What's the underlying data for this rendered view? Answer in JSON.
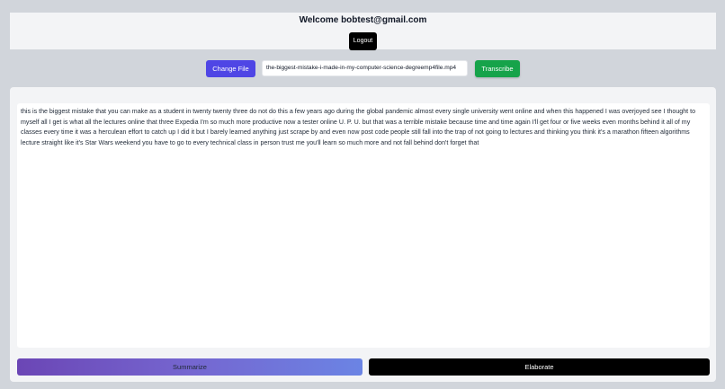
{
  "header": {
    "welcome_text": "Welcome bobtest@gmail.com",
    "logout_label": "Logout"
  },
  "toolbar": {
    "change_file_label": "Change File",
    "file_name": "the-biggest-mistake-i-made-in-my-computer-science-degreemp4file.mp4",
    "transcribe_label": "Transcribe"
  },
  "transcript": {
    "text": "this is the biggest mistake that you can make as a student in twenty twenty three do not do this a few years ago during the global pandemic almost every single university went online and when this happened I was overjoyed see I thought to myself all I get is what all the lectures online that three Expedia I'm so much more productive now a tester online U. P. U. but that was a terrible mistake because time and time again I'll get four or five weeks even months behind it all of my classes every time it was a herculean effort to catch up I did it but I barely learned anything just scrape by and even now post code people still fall into the trap of not going to lectures and thinking you think it's a marathon fifteen algorithms lecture straight like it's Star Wars weekend you have to go to every technical class in person trust me you'll learn so much more and not fall behind don't forget that"
  },
  "actions": {
    "summarize_label": "Summarize",
    "elaborate_label": "Elaborate"
  },
  "colors": {
    "background": "#d1d5db",
    "change_file": "#4f46e5",
    "transcribe": "#16a34a",
    "summarize_gradient_start": "#6b46b5",
    "summarize_gradient_end": "#6b84e4",
    "elaborate": "#000000"
  }
}
